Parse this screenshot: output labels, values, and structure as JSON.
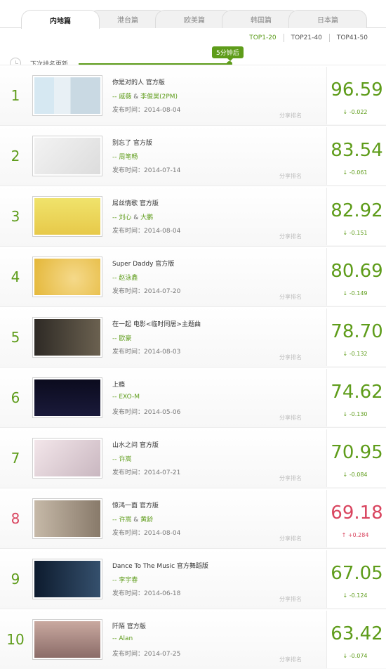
{
  "tabs": [
    "内地篇",
    "港台篇",
    "欧美篇",
    "韩国篇",
    "日本篇"
  ],
  "active_tab": 0,
  "ranges": [
    "TOP1-20",
    "TOP21-40",
    "TOP41-50"
  ],
  "countdown": {
    "label": "下次排名更新",
    "badge": "5分钟后"
  },
  "share_label": "分享排名",
  "date_prefix": "发布时间：",
  "colors": {
    "accent": "#5e9c1a",
    "down": "#5e9c1a",
    "up": "#d9455f"
  },
  "rows": [
    {
      "rank": "1",
      "title": "你是对的人 官方版",
      "artists": [
        "戚薇",
        "李俊昊(2PM)"
      ],
      "date": "2014-08-04",
      "score": "96.59",
      "delta": "-0.022",
      "trend": "down"
    },
    {
      "rank": "2",
      "title": "别忘了 官方版",
      "artists": [
        "周笔畅"
      ],
      "date": "2014-07-14",
      "score": "83.54",
      "delta": "-0.061",
      "trend": "down"
    },
    {
      "rank": "3",
      "title": "屌丝情歌 官方版",
      "artists": [
        "刘心",
        "大鹏"
      ],
      "date": "2014-08-04",
      "score": "82.92",
      "delta": "-0.151",
      "trend": "down"
    },
    {
      "rank": "4",
      "title": "Super Daddy 官方版",
      "artists": [
        "赵泳鑫"
      ],
      "date": "2014-07-20",
      "score": "80.69",
      "delta": "-0.149",
      "trend": "down"
    },
    {
      "rank": "5",
      "title": "在一起 电影<临时同居>主题曲",
      "artists": [
        "欧豪"
      ],
      "date": "2014-08-03",
      "score": "78.70",
      "delta": "-0.132",
      "trend": "down"
    },
    {
      "rank": "6",
      "title": "上瘾",
      "artists": [
        "EXO-M"
      ],
      "date": "2014-05-06",
      "score": "74.62",
      "delta": "-0.130",
      "trend": "down"
    },
    {
      "rank": "7",
      "title": "山水之间 官方版",
      "artists": [
        "许嵩"
      ],
      "date": "2014-07-21",
      "score": "70.95",
      "delta": "-0.084",
      "trend": "down"
    },
    {
      "rank": "8",
      "title": "惊鸿一面 官方版",
      "artists": [
        "许嵩",
        "黄龄"
      ],
      "date": "2014-08-04",
      "score": "69.18",
      "delta": "+0.284",
      "trend": "up"
    },
    {
      "rank": "9",
      "title": "Dance To The Music 官方舞蹈版",
      "artists": [
        "李宇春"
      ],
      "date": "2014-06-18",
      "score": "67.05",
      "delta": "-0.124",
      "trend": "down"
    },
    {
      "rank": "10",
      "title": "阡陌 官方版",
      "artists": [
        "Alan"
      ],
      "date": "2014-07-25",
      "score": "63.42",
      "delta": "-0.074",
      "trend": "down"
    }
  ]
}
